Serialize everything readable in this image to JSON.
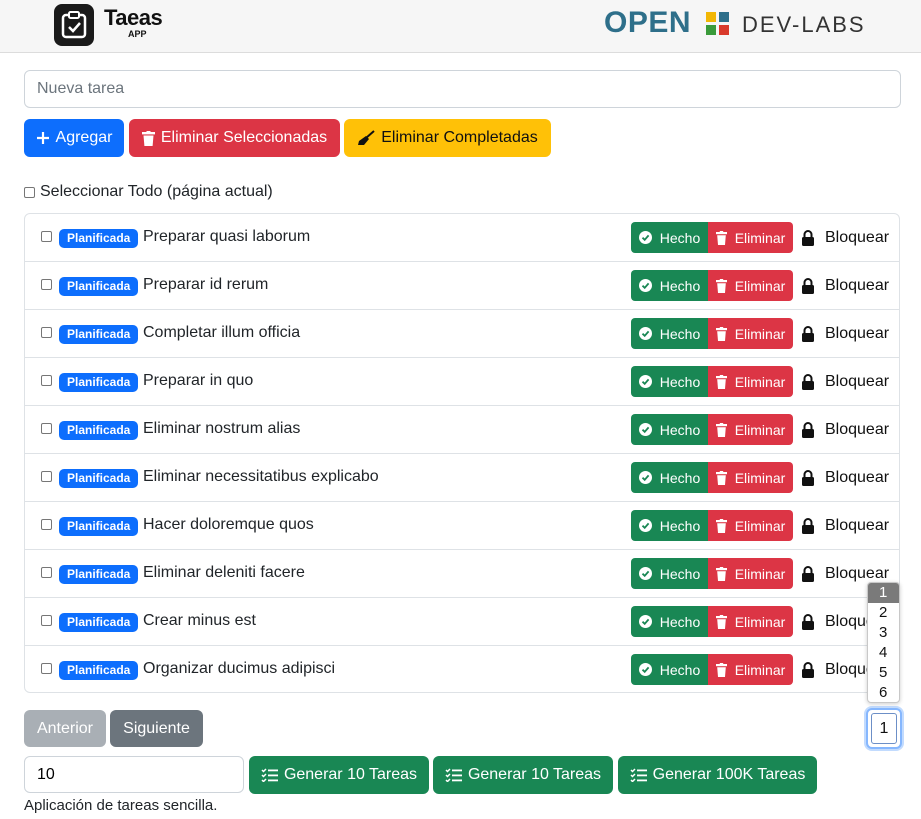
{
  "header": {
    "app_title": "Taeas",
    "app_subtitle": "APP",
    "brand_open": "OPEN",
    "brand_dev": "DEV-LABS"
  },
  "new_task": {
    "placeholder": "Nueva tarea",
    "value": ""
  },
  "toolbar": {
    "add_label": "Agregar",
    "delete_selected_label": "Eliminar Seleccionadas",
    "delete_completed_label": "Eliminar Completadas"
  },
  "select_all_label": "Seleccionar Todo (página actual)",
  "tasks": [
    {
      "status": "Planificada",
      "text": "Preparar quasi laborum"
    },
    {
      "status": "Planificada",
      "text": "Preparar id rerum"
    },
    {
      "status": "Planificada",
      "text": "Completar illum officia"
    },
    {
      "status": "Planificada",
      "text": "Preparar in quo"
    },
    {
      "status": "Planificada",
      "text": "Eliminar nostrum alias"
    },
    {
      "status": "Planificada",
      "text": "Eliminar necessitatibus explicabo"
    },
    {
      "status": "Planificada",
      "text": "Hacer doloremque quos"
    },
    {
      "status": "Planificada",
      "text": "Eliminar deleniti facere"
    },
    {
      "status": "Planificada",
      "text": "Crear minus est"
    },
    {
      "status": "Planificada",
      "text": "Organizar ducimus adipisci"
    }
  ],
  "task_actions": {
    "done_label": "Hecho",
    "delete_label": "Eliminar",
    "lock_label": "Bloquear"
  },
  "pagination": {
    "prev_label": "Anterior",
    "next_label": "Siguiente",
    "page_options": [
      "1",
      "2",
      "3",
      "4",
      "5",
      "6"
    ],
    "current_page": "1"
  },
  "generator": {
    "count_value": "10",
    "gen10_label_a": "Generar 10 Tareas",
    "gen10_label_b": "Generar 10 Tareas",
    "gen100k_label": "Generar 100K Tareas"
  },
  "footer_text": "Aplicación de tareas sencilla.",
  "colors": {
    "primary": "#0d6efd",
    "danger": "#dc3545",
    "warning": "#ffc107",
    "success": "#198754",
    "secondary": "#6c757d"
  }
}
